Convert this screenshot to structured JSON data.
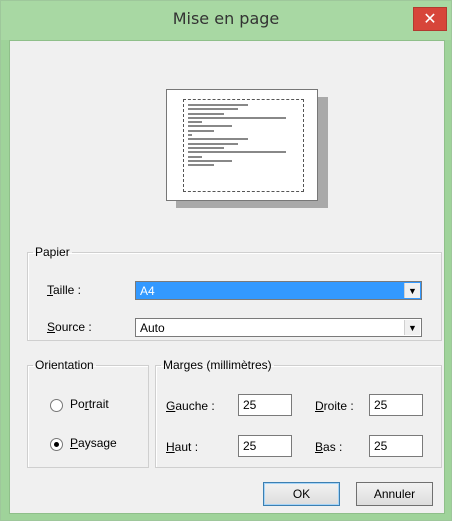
{
  "window": {
    "title": "Mise en page",
    "close_glyph": "✕"
  },
  "papier": {
    "legend": "Papier",
    "taille_label_u": "T",
    "taille_label_rest": "aille :",
    "taille_value": "A4",
    "source_label_u": "S",
    "source_label_rest": "ource :",
    "source_value": "Auto"
  },
  "orientation": {
    "legend": "Orientation",
    "portrait_pre": "Po",
    "portrait_u": "r",
    "portrait_post": "trait",
    "paysage_u": "P",
    "paysage_post": "aysage",
    "selected": "paysage"
  },
  "marges": {
    "legend": "Marges (millimètres)",
    "gauche_u": "G",
    "gauche_rest": "auche :",
    "gauche_value": "25",
    "droite_u": "D",
    "droite_rest": "roite :",
    "droite_value": "25",
    "haut_u": "H",
    "haut_rest": "aut :",
    "haut_value": "25",
    "bas_u": "B",
    "bas_rest": "as :",
    "bas_value": "25"
  },
  "buttons": {
    "ok": "OK",
    "cancel": "Annuler"
  },
  "icons": {
    "close": "close-icon",
    "dropdown": "chevron-down-icon"
  }
}
